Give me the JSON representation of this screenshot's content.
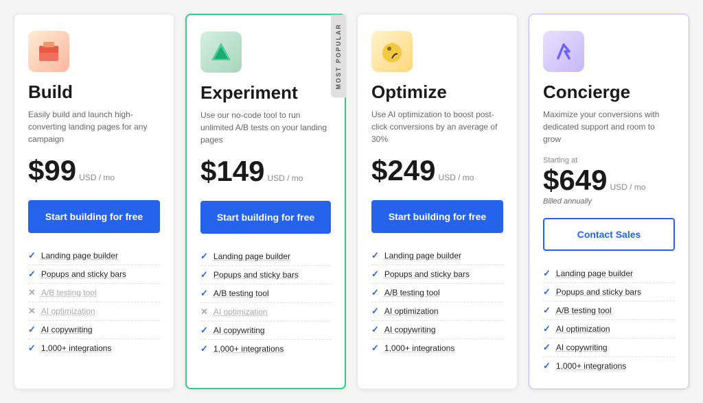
{
  "plans": [
    {
      "id": "build",
      "name": "Build",
      "desc": "Easily build and launch high-converting landing pages for any campaign",
      "price": "$99",
      "price_suffix": "USD / mo",
      "starting_at": false,
      "billed_annually": false,
      "popular": false,
      "icon_label": "🧱",
      "icon_class": "icon-build",
      "cta_label": "Start building for free",
      "cta_type": "primary",
      "features": [
        {
          "enabled": true,
          "label": "Landing page builder"
        },
        {
          "enabled": true,
          "label": "Popups and sticky bars"
        },
        {
          "enabled": false,
          "label": "A/B testing tool"
        },
        {
          "enabled": false,
          "label": "AI optimization"
        },
        {
          "enabled": true,
          "label": "AI copywriting"
        },
        {
          "enabled": true,
          "label": "1,000+ integrations"
        }
      ]
    },
    {
      "id": "experiment",
      "name": "Experiment",
      "desc": "Use our no-code tool to run unlimited A/B tests on your landing pages",
      "price": "$149",
      "price_suffix": "USD / mo",
      "starting_at": false,
      "billed_annually": false,
      "popular": true,
      "icon_label": "🌱",
      "icon_class": "icon-experiment",
      "cta_label": "Start building for free",
      "cta_type": "primary",
      "features": [
        {
          "enabled": true,
          "label": "Landing page builder"
        },
        {
          "enabled": true,
          "label": "Popups and sticky bars"
        },
        {
          "enabled": true,
          "label": "A/B testing tool"
        },
        {
          "enabled": false,
          "label": "AI optimization"
        },
        {
          "enabled": true,
          "label": "AI copywriting"
        },
        {
          "enabled": true,
          "label": "1,000+ integrations"
        }
      ]
    },
    {
      "id": "optimize",
      "name": "Optimize",
      "desc": "Use AI optimization to boost post-click conversions by an average of 30%",
      "price": "$249",
      "price_suffix": "USD / mo",
      "starting_at": false,
      "billed_annually": false,
      "popular": false,
      "icon_label": "🐷",
      "icon_class": "icon-optimize",
      "cta_label": "Start building for free",
      "cta_type": "primary",
      "features": [
        {
          "enabled": true,
          "label": "Landing page builder"
        },
        {
          "enabled": true,
          "label": "Popups and sticky bars"
        },
        {
          "enabled": true,
          "label": "A/B testing tool"
        },
        {
          "enabled": true,
          "label": "AI optimization"
        },
        {
          "enabled": true,
          "label": "AI copywriting"
        },
        {
          "enabled": true,
          "label": "1,000+ integrations"
        }
      ]
    },
    {
      "id": "concierge",
      "name": "Concierge",
      "desc": "Maximize your conversions with dedicated support and room to grow",
      "price": "$649",
      "price_suffix": "USD / mo",
      "starting_at": true,
      "starting_at_label": "Starting at",
      "billed_annually": true,
      "billed_annually_label": "Billed annually",
      "popular": false,
      "icon_label": "↗",
      "icon_class": "icon-concierge",
      "cta_label": "Contact Sales",
      "cta_type": "outline",
      "features": [
        {
          "enabled": true,
          "label": "Landing page builder"
        },
        {
          "enabled": true,
          "label": "Popups and sticky bars"
        },
        {
          "enabled": true,
          "label": "A/B testing tool"
        },
        {
          "enabled": true,
          "label": "AI optimization"
        },
        {
          "enabled": true,
          "label": "AI copywriting"
        },
        {
          "enabled": true,
          "label": "1,000+ integrations"
        }
      ]
    }
  ],
  "most_popular_badge": "Most Popular"
}
